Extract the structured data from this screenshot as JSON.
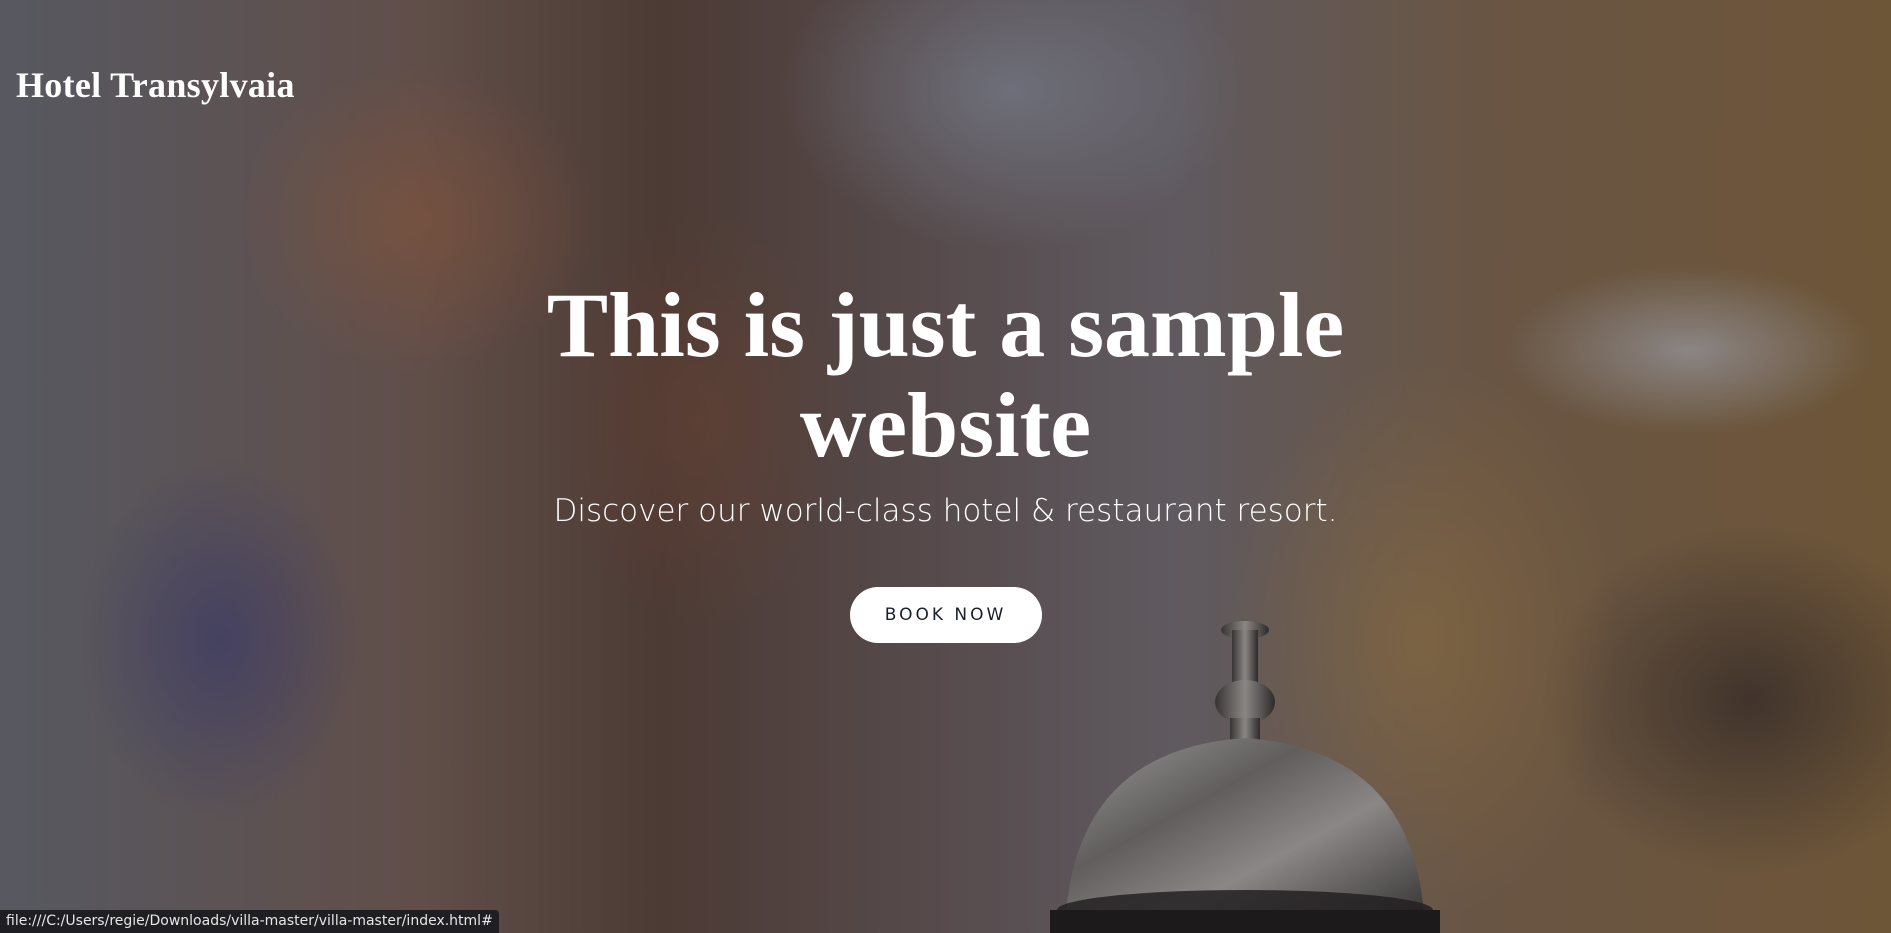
{
  "brand": {
    "name": "Hotel Transylvaia"
  },
  "hero": {
    "title": "This is just a sample website",
    "subtitle": "Discover our world-class hotel & restaurant resort.",
    "cta_label": "BOOK NOW",
    "background_image": "hotel-reception-bell-icon"
  },
  "status_bar": {
    "url": "file:///C:/Users/regie/Downloads/villa-master/villa-master/index.html#"
  }
}
